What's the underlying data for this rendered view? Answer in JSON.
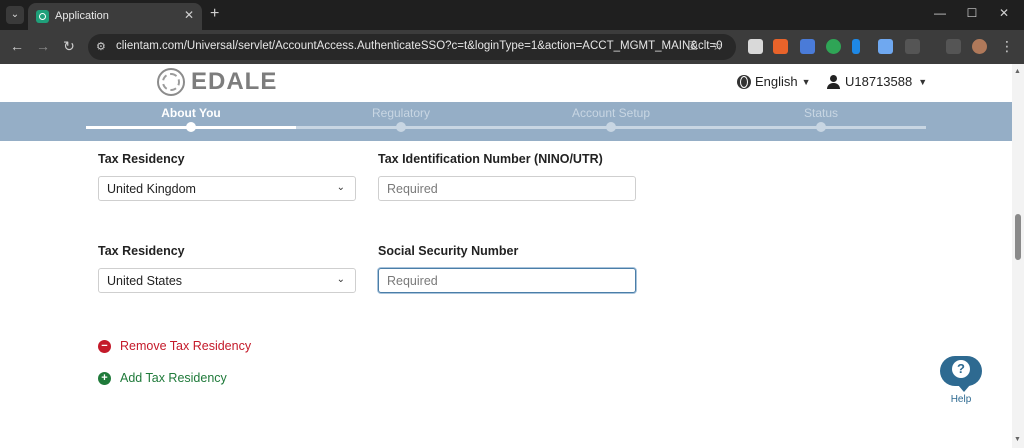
{
  "browser": {
    "tab_title": "Application",
    "url": "clientam.com/Universal/servlet/AccountAccess.AuthenticateSSO?c=t&loginType=1&action=ACCT_MGMT_MAIN&clt=0"
  },
  "header": {
    "brand": "EDALE",
    "language": "English",
    "username": "U18713588"
  },
  "steps": [
    {
      "label": "About You",
      "active": true
    },
    {
      "label": "Regulatory",
      "active": false
    },
    {
      "label": "Account Setup",
      "active": false
    },
    {
      "label": "Status",
      "active": false
    }
  ],
  "form": {
    "row1": {
      "residency_label": "Tax Residency",
      "residency_value": "United Kingdom",
      "id_label": "Tax Identification Number (NINO/UTR)",
      "id_placeholder": "Required"
    },
    "row2": {
      "residency_label": "Tax Residency",
      "residency_value": "United States",
      "id_label": "Social Security Number",
      "id_placeholder": "Required"
    },
    "remove_label": "Remove Tax Residency",
    "add_label": "Add Tax Residency"
  },
  "help": {
    "label": "Help",
    "glyph": "?"
  },
  "colors": {
    "stepper_bg": "#95aec6",
    "remove": "#c41a2a",
    "add": "#1f7a3a",
    "help": "#2e6a91"
  }
}
